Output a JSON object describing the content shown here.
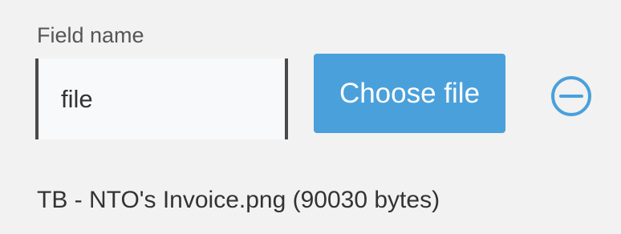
{
  "field": {
    "label": "Field name",
    "value": "file"
  },
  "choose_button": {
    "label": "Choose file"
  },
  "remove_button": {
    "icon": "minus-circle-icon",
    "color": "#4aa0db"
  },
  "file_info": {
    "text": "TB - NTO's Invoice.png (90030 bytes)"
  },
  "colors": {
    "accent": "#4aa0db",
    "background": "#f2f2f2"
  }
}
